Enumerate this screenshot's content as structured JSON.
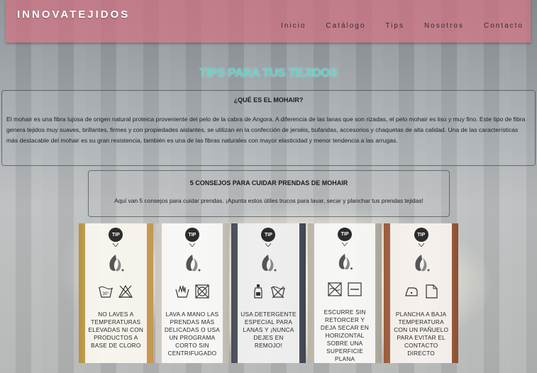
{
  "brand": "INNOVATEJIDOS",
  "nav": [
    "Inicio",
    "Catálogo",
    "Tips",
    "Nosotros",
    "Contacto"
  ],
  "page_title": "TIPS PARA TUS TEJIDOS",
  "section1": {
    "heading": "¿QUÉ ES EL MOHAIR?",
    "body": "El mohair es una fibra lujosa de origen natural proteica proveniente del pelo de la cabra de Angora. A diferencia de las lanas que son rizadas, el pelo mohair es liso y muy fino. Este tipo de fibra genera tejidos muy suaves, brillantes, firmes y con propiedades aislantes, se utilizan en la confección de jerséis, bufandas, accesorios y chaquetas de alta calidad. Una de las características más destacable del mohair es su gran resistencia, también es una de las fibras naturales con mayor elasticidad y menor tendencia a las arrugas."
  },
  "section2": {
    "heading": "5 CONSEJOS PARA CUIDAR PRENDAS DE MOHAIR",
    "body": "Aquí van 5 consejos para cuidar prendas. ¡Apunta estos útiles trucos para lavar, secar y planchar tus prendas tejidas!"
  },
  "tip_badge": "TIP",
  "wash_temp": "30°",
  "tips": [
    {
      "text": "NO LAVES A TEMPERATURAS ELEVADAS NI CON PRODUCTOS A BASE DE CLORO",
      "icons": [
        "wash-30-icon",
        "no-bleach-icon"
      ]
    },
    {
      "text": "LAVA A MANO LAS PRENDAS MÁS DELICADAS O USA UN PROGRAMA CORTO SIN CENTRIFUGADO",
      "icons": [
        "hand-wash-icon",
        "no-tumble-dry-icon"
      ]
    },
    {
      "text": "USA DETERGENTE ESPECIAL PARA LANAS Y ¡NUNCA DEJES EN REMOJO!",
      "icons": [
        "detergent-bottle-icon",
        "no-soak-icon"
      ]
    },
    {
      "text": "ESCURRE SIN RETORCER Y DEJA SECAR EN HORIZONTAL SOBRE UNA SUPERFICIE PLANA",
      "icons": [
        "no-wring-icon",
        "dry-flat-icon"
      ]
    },
    {
      "text": "PLANCHA A BAJA TEMPERATURA CON UN PAÑUELO PARA EVITAR EL CONTACTO DIRECTO",
      "icons": [
        "iron-low-icon",
        "pressing-cloth-icon"
      ]
    }
  ]
}
